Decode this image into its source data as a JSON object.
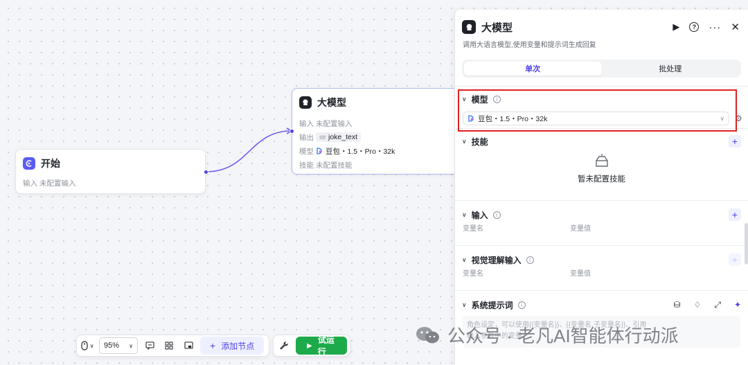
{
  "canvas": {
    "start_node": {
      "title": "开始",
      "rows": [
        {
          "label": "输入",
          "value": "未配置输入"
        }
      ]
    },
    "llm_node": {
      "title": "大模型",
      "input_label": "输入",
      "input_value": "未配置输入",
      "output_label": "输出",
      "output_type": "str",
      "output_value": "joke_text",
      "model_label": "模型",
      "model_value": "豆包・1.5・Pro・32k",
      "skill_label": "技能",
      "skill_value": "未配置技能"
    }
  },
  "toolbar": {
    "zoom": "95%",
    "add_node": "添加节点",
    "run": "试运行"
  },
  "panel": {
    "title": "大模型",
    "description": "调用大语言模型,使用变量和提示词生成回复",
    "tabs": [
      {
        "label": "单次",
        "active": true
      },
      {
        "label": "批处理",
        "active": false
      }
    ],
    "model_section": {
      "title": "模型",
      "selected": "豆包・1.5・Pro・32k"
    },
    "skills_section": {
      "title": "技能",
      "empty_text": "暂未配置技能"
    },
    "input_section": {
      "title": "输入",
      "col_name": "变量名",
      "col_value": "变量值"
    },
    "vision_section": {
      "title": "视觉理解输入",
      "col_name": "变量名",
      "col_value": "变量值"
    },
    "system_prompt_section": {
      "title": "系统提示词",
      "placeholder_line1": "角色设定，可以使用{{变量名}}、{{变量名.子变量名}}、引用",
      "placeholder_line2": "输入参数中的变量"
    }
  },
  "watermark": {
    "text": "公众号 · 老凡AI智能体行动派"
  },
  "colors": {
    "accent": "#4e40e5",
    "run": "#1daa4a",
    "highlight": "#e02020"
  }
}
